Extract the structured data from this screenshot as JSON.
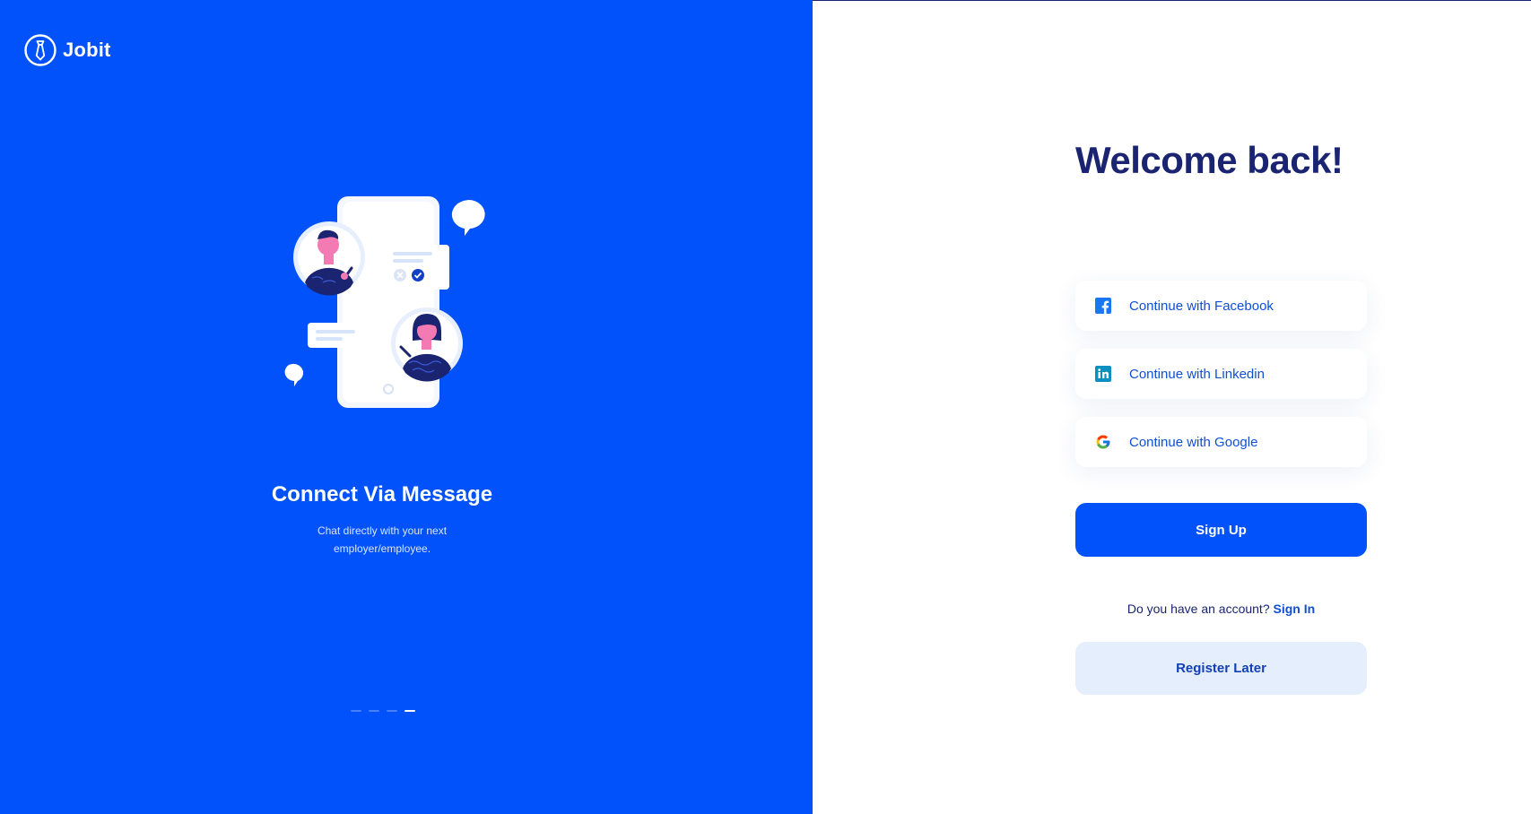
{
  "brand": {
    "name": "Jobit"
  },
  "carousel": {
    "title": "Connect Via Message",
    "description": "Chat directly with your next employer/employee.",
    "total_slides": 4,
    "active_slide": 4
  },
  "auth": {
    "heading": "Welcome back!",
    "facebook_label": "Continue with Facebook",
    "linkedin_label": "Continue with Linkedin",
    "google_label": "Continue with Google",
    "signup_label": "Sign Up",
    "account_prompt": "Do you have an account?",
    "signin_label": "Sign In",
    "register_later_label": "Register Later"
  },
  "colors": {
    "primary": "#0152fb",
    "heading": "#1a2470",
    "link": "#0f4fd6",
    "secondary_button": "#e5eefc",
    "facebook": "#1877f2",
    "linkedin": "#0a66c2"
  },
  "icons": {
    "logo": "tie-logo-icon",
    "facebook": "facebook-icon",
    "linkedin": "linkedin-icon",
    "google": "google-icon"
  }
}
